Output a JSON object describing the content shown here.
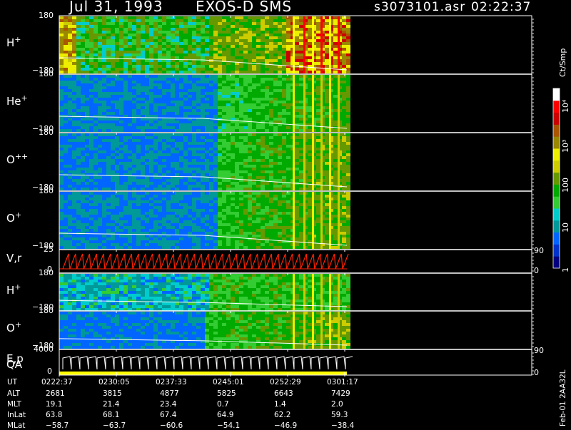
{
  "header": {
    "date": "Jul 31, 1993",
    "instrument": "EXOS-D SMS",
    "file": "s3073101.asr",
    "time": "02:22:37"
  },
  "colorbar": {
    "unit": "Ct/Smp",
    "tick_labels": [
      "1",
      "10",
      "100",
      "10³",
      "10⁴"
    ],
    "colors": [
      "#000080",
      "#0033cc",
      "#0066ff",
      "#009999",
      "#00cccc",
      "#33cc33",
      "#00aa00",
      "#669900",
      "#cccc00",
      "#eeee00",
      "#998800",
      "#aa5500",
      "#cc0000",
      "#ff0000",
      "#ffffff"
    ]
  },
  "panels": [
    {
      "id": "h-plus-1",
      "label": "H",
      "sup": "+",
      "ymax": "180",
      "ymin": "−180"
    },
    {
      "id": "he-plus",
      "label": "He",
      "sup": "+",
      "ymax": "180",
      "ymin": "−180"
    },
    {
      "id": "o-plusplus",
      "label": "O",
      "sup": "++",
      "ymax": "180",
      "ymin": "−180"
    },
    {
      "id": "o-plus-1",
      "label": "O",
      "sup": "+",
      "ymax": "180",
      "ymin": "−180"
    },
    {
      "id": "vr",
      "label": "V,r",
      "sup": "",
      "ymax": "25",
      "ymin": "0",
      "right_max": "90",
      "right_min": "0"
    },
    {
      "id": "h-plus-2",
      "label": "H",
      "sup": "+",
      "ymax": "180",
      "ymin": "−180"
    },
    {
      "id": "o-plus-2",
      "label": "O",
      "sup": "+",
      "ymax": "180",
      "ymin": "−180"
    },
    {
      "id": "ep",
      "label": "E,p",
      "label2": "QA",
      "sup": "",
      "ymax": "4000",
      "ymin": "0",
      "right_max": "90",
      "right_min": "0"
    }
  ],
  "ephemeris": {
    "row_labels": [
      "UT",
      "ALT",
      "MLT",
      "InLat",
      "MLat"
    ],
    "columns": [
      [
        "0222:37",
        "2681",
        "19.1",
        "63.8",
        "−58.7"
      ],
      [
        "0230:05",
        "3815",
        "21.4",
        "68.1",
        "−63.7"
      ],
      [
        "0237:33",
        "4877",
        "23.4",
        "67.4",
        "−60.6"
      ],
      [
        "0245:01",
        "5825",
        "0.7",
        "64.9",
        "−54.1"
      ],
      [
        "0252:29",
        "6643",
        "1.4",
        "62.2",
        "−46.9"
      ],
      [
        "0301:17",
        "7429",
        "2.0",
        "59.3",
        "−38.4"
      ]
    ]
  },
  "side_text": "Feb-01 2AA32L",
  "chart_data": {
    "type": "heatmap",
    "title": "Jul 31, 1993   EXOS-D SMS",
    "x_tick_labels": [
      "0222:37",
      "0230:05",
      "0237:33",
      "0245:01",
      "0252:29",
      "0301:17"
    ],
    "colorbar_unit": "Ct/Smp",
    "colorbar_scale": "log",
    "colorbar_range": [
      1,
      10000
    ],
    "data_extent": "0222:37 – 0301:17",
    "series": [
      {
        "name": "H+",
        "y_range": [
          -180,
          180
        ]
      },
      {
        "name": "He+",
        "y_range": [
          -180,
          180
        ]
      },
      {
        "name": "O++",
        "y_range": [
          -180,
          180
        ]
      },
      {
        "name": "O+",
        "y_range": [
          -180,
          180
        ]
      },
      {
        "name": "V,r",
        "y_range": [
          0,
          25
        ],
        "right_axis": [
          0,
          90
        ]
      },
      {
        "name": "H+",
        "y_range": [
          -180,
          180
        ]
      },
      {
        "name": "O+",
        "y_range": [
          -180,
          180
        ]
      },
      {
        "name": "E,p",
        "y_range": [
          0,
          4000
        ],
        "right_axis": [
          0,
          90
        ]
      }
    ]
  }
}
